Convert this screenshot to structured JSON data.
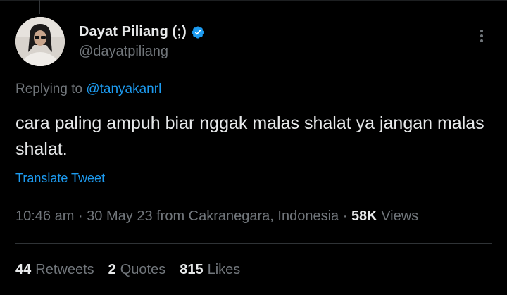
{
  "author": {
    "display_name": "Dayat Piliang (;)",
    "handle": "@dayatpiliang",
    "verified_icon": "verified-badge-icon",
    "verified_color": "#1d9bf0"
  },
  "reply": {
    "prefix": "Replying to ",
    "to_handle": "@tanyakanrl"
  },
  "tweet": {
    "text": "cara paling ampuh biar nggak malas shalat ya jangan malas shalat.",
    "translate_label": "Translate Tweet"
  },
  "meta": {
    "time": "10:46 am",
    "sep1": " · ",
    "date": "30 May 23",
    "source": " from Cakranegara, Indonesia",
    "sep2": " · ",
    "views_count": "58K",
    "views_label": " Views"
  },
  "stats": {
    "retweets_count": "44",
    "retweets_label": "Retweets",
    "quotes_count": "2",
    "quotes_label": "Quotes",
    "likes_count": "815",
    "likes_label": "Likes"
  },
  "colors": {
    "background": "#000000",
    "text": "#e7e9ea",
    "secondary": "#71767b",
    "accent": "#1d9bf0"
  }
}
